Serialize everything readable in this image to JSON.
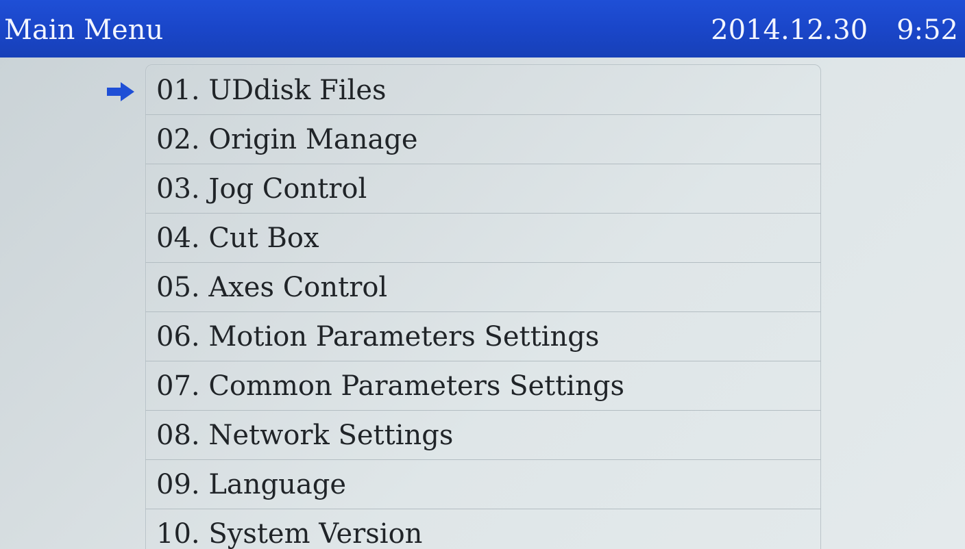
{
  "header": {
    "title": "Main Menu",
    "date": "2014.12.30",
    "time": "9:52"
  },
  "selection_icon": "right-arrow-icon",
  "colors": {
    "titlebar": "#1a46c9",
    "arrow": "#1f4fd6",
    "text": "#202428"
  },
  "menu": {
    "selected_index": 0,
    "items": [
      {
        "label": "01. UDdisk Files"
      },
      {
        "label": "02. Origin Manage"
      },
      {
        "label": "03. Jog Control"
      },
      {
        "label": "04. Cut Box"
      },
      {
        "label": "05. Axes Control"
      },
      {
        "label": "06. Motion Parameters Settings"
      },
      {
        "label": "07. Common Parameters Settings"
      },
      {
        "label": "08. Network Settings"
      },
      {
        "label": "09. Language"
      },
      {
        "label": "10. System Version"
      }
    ]
  }
}
